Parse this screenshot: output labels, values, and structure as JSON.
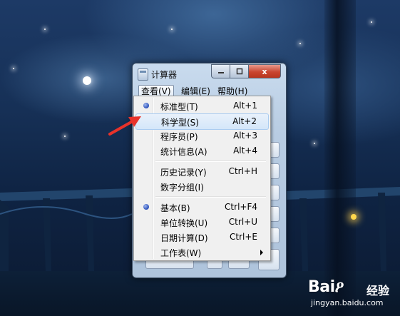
{
  "window": {
    "title": "计算器",
    "minimize_icon": "minimize-icon",
    "maximize_icon": "maximize-icon",
    "close_icon": "close-icon",
    "close_glyph": "x"
  },
  "menubar": {
    "view": "查看(V)",
    "edit": "编辑(E)",
    "help": "帮助(H)"
  },
  "view_menu": {
    "items": [
      {
        "label": "标准型(T)",
        "shortcut": "Alt+1",
        "checked": true
      },
      {
        "label": "科学型(S)",
        "shortcut": "Alt+2",
        "highlighted": true
      },
      {
        "label": "程序员(P)",
        "shortcut": "Alt+3"
      },
      {
        "label": "统计信息(A)",
        "shortcut": "Alt+4"
      },
      {
        "label": "历史记录(Y)",
        "shortcut": "Ctrl+H"
      },
      {
        "label": "数字分组(I)",
        "shortcut": ""
      },
      {
        "label": "基本(B)",
        "shortcut": "Ctrl+F4",
        "checked": true
      },
      {
        "label": "单位转换(U)",
        "shortcut": "Ctrl+U"
      },
      {
        "label": "日期计算(D)",
        "shortcut": "Ctrl+E"
      },
      {
        "label": "工作表(W)",
        "shortcut": "",
        "submenu": true
      }
    ]
  },
  "watermark": {
    "brand": "Baiዖ",
    "product": "经验",
    "url": "jingyan.baidu.com"
  },
  "colors": {
    "pointer_arrow": "#e8322a",
    "radio_dot": "#2a4fb8",
    "highlight_border": "#aaccf0"
  }
}
